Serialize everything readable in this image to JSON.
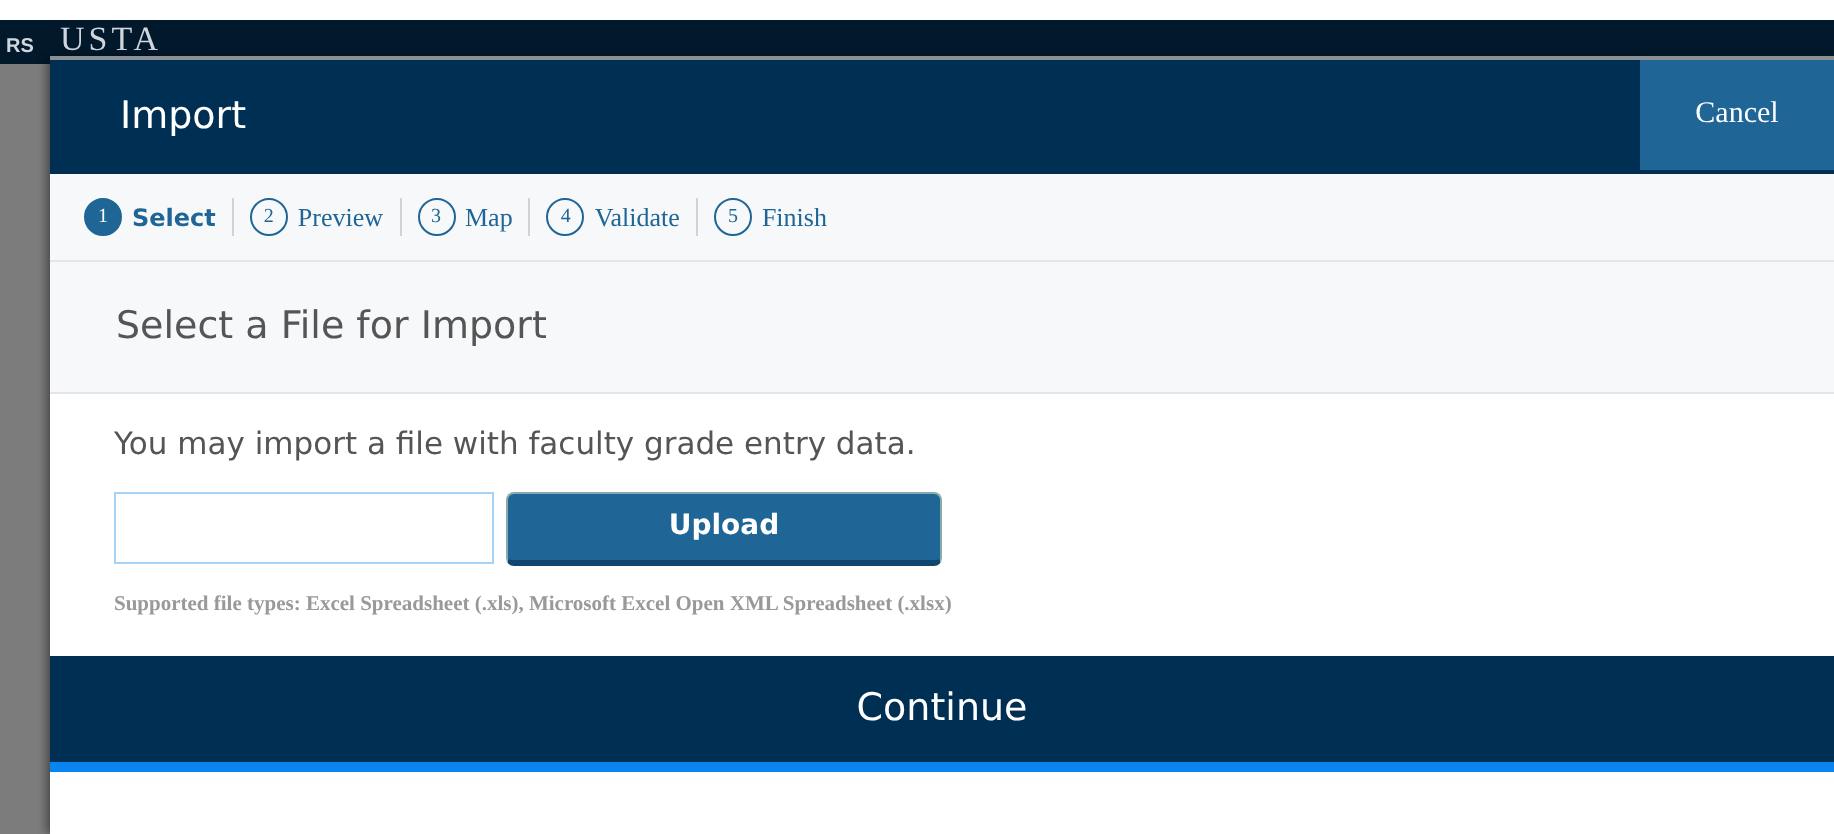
{
  "background": {
    "logo_text": "USTA",
    "logo_subtext": "RS"
  },
  "dialog": {
    "title": "Import",
    "cancel_label": "Cancel"
  },
  "steps": [
    {
      "number": "1",
      "label": "Select",
      "selected": true
    },
    {
      "number": "2",
      "label": "Preview",
      "selected": false
    },
    {
      "number": "3",
      "label": "Map",
      "selected": false
    },
    {
      "number": "4",
      "label": "Validate",
      "selected": false
    },
    {
      "number": "5",
      "label": "Finish",
      "selected": false
    }
  ],
  "section": {
    "title": "Select a File for Import",
    "description": "You may import a file with faculty grade entry data.",
    "upload_label": "Upload",
    "supported_types": "Supported file types: Excel Spreadsheet (.xls), Microsoft Excel Open XML Spreadsheet (.xlsx)"
  },
  "continue_label": "Continue"
}
